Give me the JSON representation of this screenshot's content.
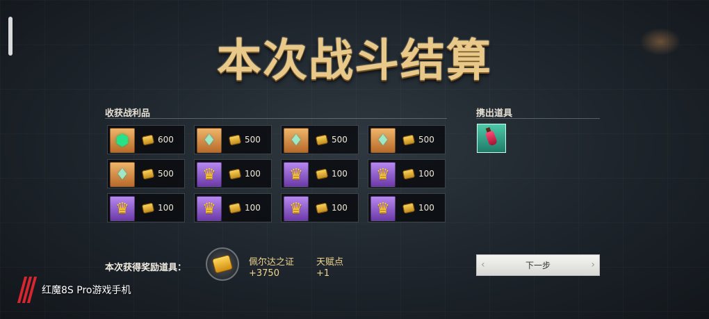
{
  "title": "本次战斗结算",
  "loot": {
    "label": "收获战利品",
    "items": [
      {
        "icon": "green-gem-icon",
        "rarity": "orange",
        "qty": "600"
      },
      {
        "icon": "crystal-icon",
        "rarity": "orange",
        "qty": "500"
      },
      {
        "icon": "crystal-icon",
        "rarity": "orange",
        "qty": "500"
      },
      {
        "icon": "crystal-icon",
        "rarity": "orange",
        "qty": "500"
      },
      {
        "icon": "crystal-icon",
        "rarity": "orange",
        "qty": "500"
      },
      {
        "icon": "crown-icon",
        "rarity": "purple",
        "qty": "100"
      },
      {
        "icon": "crown-icon",
        "rarity": "purple",
        "qty": "100"
      },
      {
        "icon": "crown-icon",
        "rarity": "purple",
        "qty": "100"
      },
      {
        "icon": "crown-icon",
        "rarity": "purple",
        "qty": "100"
      },
      {
        "icon": "crown-icon",
        "rarity": "purple",
        "qty": "100"
      },
      {
        "icon": "crown-icon",
        "rarity": "purple",
        "qty": "100"
      },
      {
        "icon": "crown-icon",
        "rarity": "purple",
        "qty": "100"
      }
    ]
  },
  "dropped": {
    "label": "携出道具",
    "items": [
      {
        "icon": "potion-icon",
        "rarity": "teal"
      }
    ]
  },
  "rewards": {
    "label": "本次获得奖励道具：",
    "items": [
      {
        "name": "佩尔达之证",
        "value": "+3750"
      },
      {
        "name": "天赋点",
        "value": "+1"
      }
    ]
  },
  "next_button": "下一步",
  "watermark": "红魔8S Pro游戏手机",
  "colors": {
    "accent_gold": "#e8c98a",
    "rarity_orange": "#d98c45",
    "rarity_purple": "#8c5cd0"
  }
}
